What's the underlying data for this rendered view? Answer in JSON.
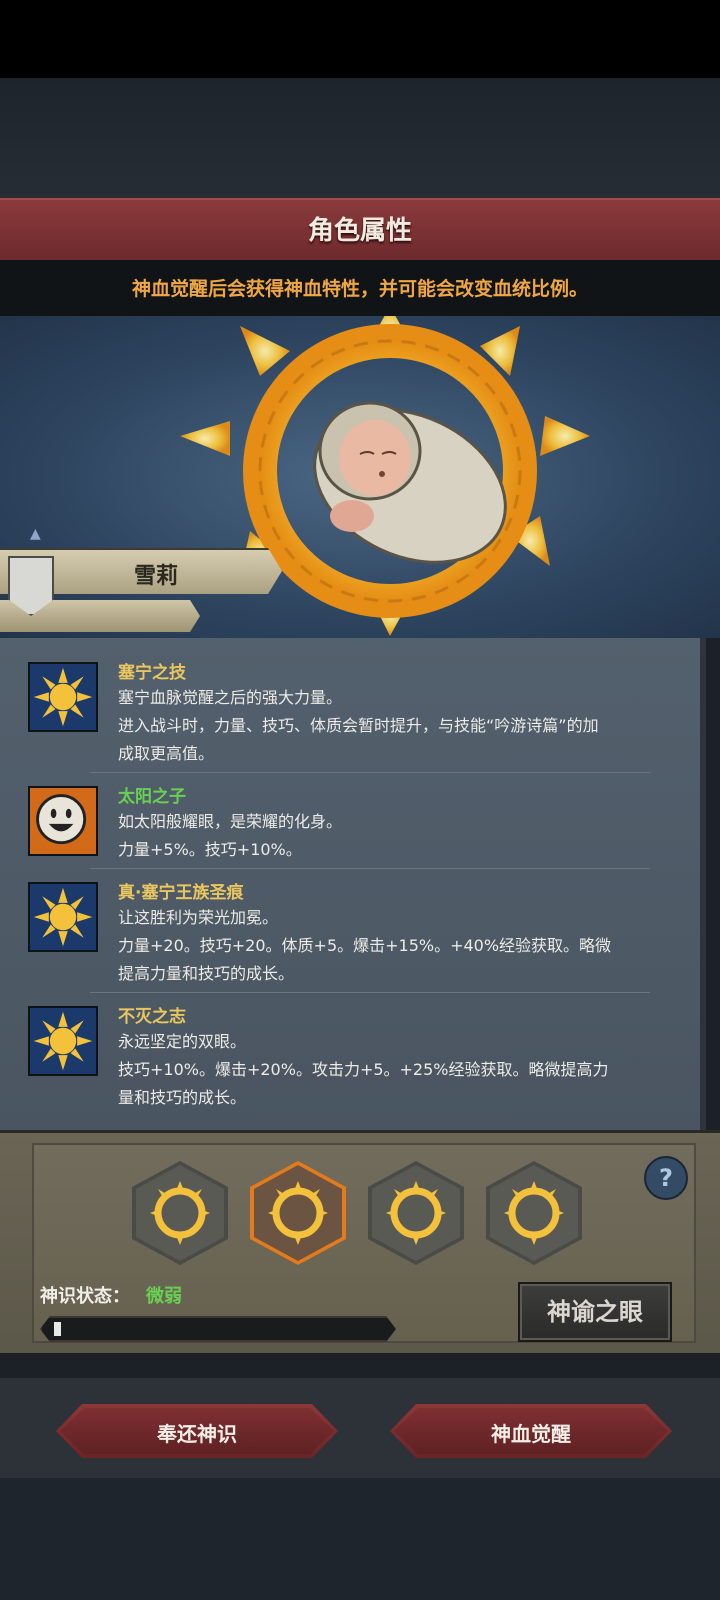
{
  "header": {
    "title": "角色属性",
    "subtitle": "神血觉醒后会获得神血特性，并可能会改变血统比例。"
  },
  "character": {
    "name": "雪莉"
  },
  "traits": [
    {
      "name": "塞宁之技",
      "lines": [
        "塞宁血脉觉醒之后的强大力量。",
        "进入战斗时，力量、技巧、体质会暂时提升，与技能“吟游诗篇”的加",
        "成取更高值。"
      ]
    },
    {
      "name": "太阳之子",
      "lines": [
        "如太阳般耀眼，是荣耀的化身。",
        "力量+5%。技巧+10%。"
      ]
    },
    {
      "name": "真·塞宁王族圣痕",
      "lines": [
        "让这胜利为荣光加冕。",
        "力量+20。技巧+20。体质+5。爆击+15%。+40%经验获取。略微",
        "提高力量和技巧的成长。"
      ]
    },
    {
      "name": "不灭之志",
      "lines": [
        "永远坚定的双眼。",
        "技巧+10%。爆击+20%。攻击力+5。+25%经验获取。略微提高力",
        "量和技巧的成长。"
      ]
    }
  ],
  "panel": {
    "help_symbol": "?",
    "status_label": "神识状态：",
    "status_value": "微弱",
    "progress": 0.02,
    "oracle_button": "神谕之眼"
  },
  "actions": {
    "return_button": "奉还神识",
    "awaken_button": "神血觉醒"
  },
  "colors": {
    "title_red": "#7a3032",
    "subtitle_orange": "#f0a742",
    "trait_gold": "#e9c65e",
    "trait_green": "#69d152",
    "hex_active": "#e37b1c"
  }
}
